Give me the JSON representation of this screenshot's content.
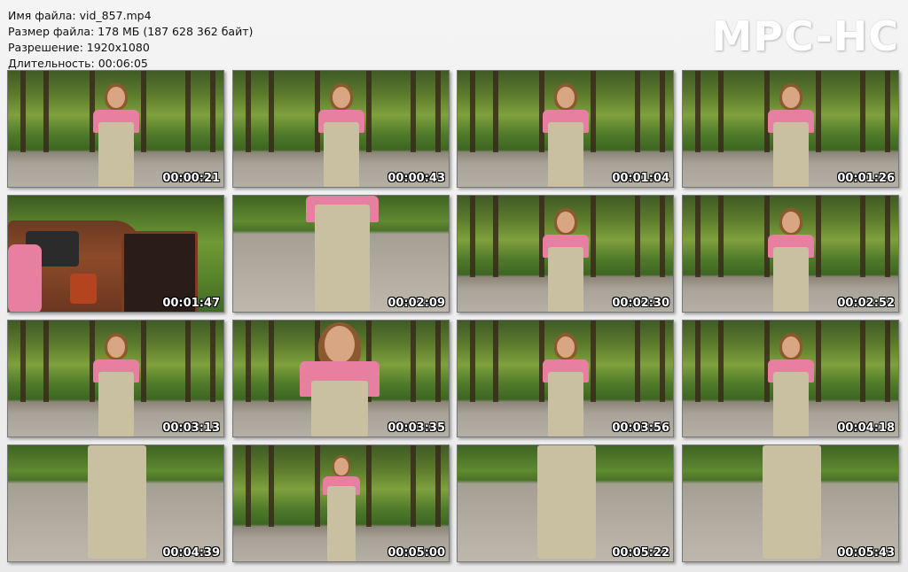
{
  "info": {
    "file_name": "Имя файла: vid_857.mp4",
    "file_size": "Размер файла: 178 МБ (187 628 362 байт)",
    "resolution": "Разрешение: 1920x1080",
    "duration": "Длительность: 00:06:05"
  },
  "logo": "MPC-HC",
  "thumbnails": [
    {
      "time": "00:00:21",
      "scene": "forest-full"
    },
    {
      "time": "00:00:43",
      "scene": "forest-full"
    },
    {
      "time": "00:01:04",
      "scene": "forest-full"
    },
    {
      "time": "00:01:26",
      "scene": "forest-full"
    },
    {
      "time": "00:01:47",
      "scene": "car"
    },
    {
      "time": "00:02:09",
      "scene": "closeup-torso"
    },
    {
      "time": "00:02:30",
      "scene": "forest-full"
    },
    {
      "time": "00:02:52",
      "scene": "forest-full"
    },
    {
      "time": "00:03:13",
      "scene": "forest-full"
    },
    {
      "time": "00:03:35",
      "scene": "forest-medium"
    },
    {
      "time": "00:03:56",
      "scene": "forest-full"
    },
    {
      "time": "00:04:18",
      "scene": "forest-full"
    },
    {
      "time": "00:04:39",
      "scene": "road-legs"
    },
    {
      "time": "00:05:00",
      "scene": "forest-far"
    },
    {
      "time": "00:05:22",
      "scene": "road-legs"
    },
    {
      "time": "00:05:43",
      "scene": "road-legs"
    }
  ]
}
